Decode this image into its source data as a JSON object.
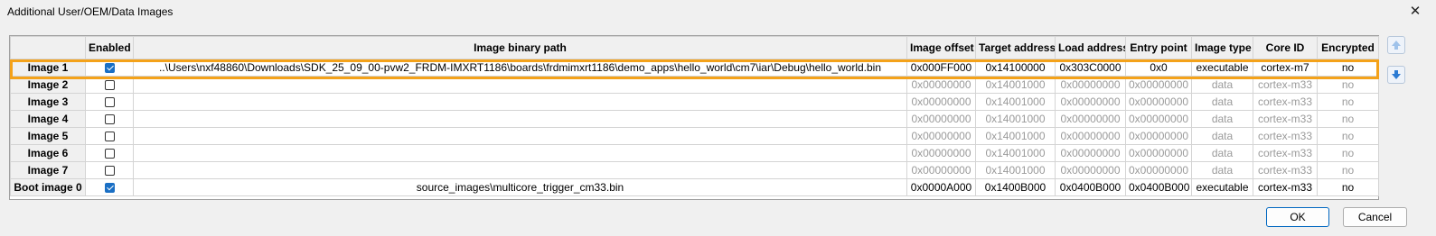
{
  "window": {
    "title": "Additional User/OEM/Data Images",
    "close_icon": "close-icon"
  },
  "columns": [
    "",
    "Enabled",
    "Image binary path",
    "Image offset",
    "Target address",
    "Load address",
    "Entry point",
    "Image type",
    "Core ID",
    "Encrypted"
  ],
  "rows": [
    {
      "name": "Image 1",
      "enabled": true,
      "path": "..\\Users\\nxf48860\\Downloads\\SDK_25_09_00-pvw2_FRDM-IMXRT1186\\boards\\frdmimxrt1186\\demo_apps\\hello_world\\cm7\\iar\\Debug\\hello_world.bin",
      "offset": "0x000FF000",
      "target": "0x14100000",
      "load": "0x303C0000",
      "entry": "0x0",
      "type": "executable",
      "core": "cortex-m7",
      "encrypted": "no"
    },
    {
      "name": "Image 2",
      "enabled": false,
      "path": "",
      "offset": "0x00000000",
      "target": "0x14001000",
      "load": "0x00000000",
      "entry": "0x00000000",
      "type": "data",
      "core": "cortex-m33",
      "encrypted": "no"
    },
    {
      "name": "Image 3",
      "enabled": false,
      "path": "",
      "offset": "0x00000000",
      "target": "0x14001000",
      "load": "0x00000000",
      "entry": "0x00000000",
      "type": "data",
      "core": "cortex-m33",
      "encrypted": "no"
    },
    {
      "name": "Image 4",
      "enabled": false,
      "path": "",
      "offset": "0x00000000",
      "target": "0x14001000",
      "load": "0x00000000",
      "entry": "0x00000000",
      "type": "data",
      "core": "cortex-m33",
      "encrypted": "no"
    },
    {
      "name": "Image 5",
      "enabled": false,
      "path": "",
      "offset": "0x00000000",
      "target": "0x14001000",
      "load": "0x00000000",
      "entry": "0x00000000",
      "type": "data",
      "core": "cortex-m33",
      "encrypted": "no"
    },
    {
      "name": "Image 6",
      "enabled": false,
      "path": "",
      "offset": "0x00000000",
      "target": "0x14001000",
      "load": "0x00000000",
      "entry": "0x00000000",
      "type": "data",
      "core": "cortex-m33",
      "encrypted": "no"
    },
    {
      "name": "Image 7",
      "enabled": false,
      "path": "",
      "offset": "0x00000000",
      "target": "0x14001000",
      "load": "0x00000000",
      "entry": "0x00000000",
      "type": "data",
      "core": "cortex-m33",
      "encrypted": "no"
    },
    {
      "name": "Boot image 0",
      "enabled": true,
      "path": "source_images\\multicore_trigger_cm33.bin",
      "offset": "0x0000A000",
      "target": "0x1400B000",
      "load": "0x0400B000",
      "entry": "0x0400B000",
      "type": "executable",
      "core": "cortex-m33",
      "encrypted": "no"
    }
  ],
  "side_buttons": {
    "up_icon": "arrow-up-icon",
    "down_icon": "arrow-down-icon"
  },
  "buttons": {
    "ok": "OK",
    "cancel": "Cancel"
  },
  "colors": {
    "highlight": "#f4a21a",
    "checkbox_checked": "#1a6fc4",
    "arrow": "#2b7bd3"
  }
}
